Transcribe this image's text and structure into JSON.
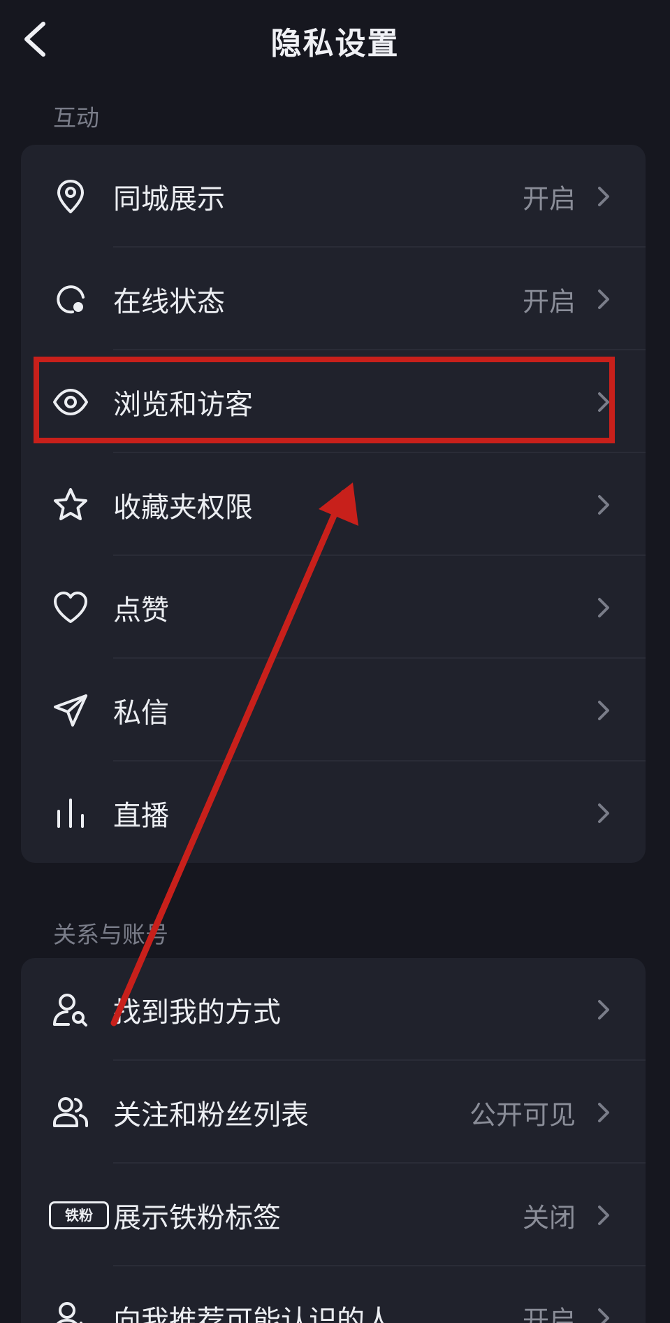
{
  "header": {
    "title": "隐私设置"
  },
  "sections": [
    {
      "title": "互动",
      "items": [
        {
          "label": "同城展示",
          "value": "开启",
          "icon": "location-pin-icon"
        },
        {
          "label": "在线状态",
          "value": "开启",
          "icon": "online-status-icon"
        },
        {
          "label": "浏览和访客",
          "value": "",
          "icon": "eye-icon"
        },
        {
          "label": "收藏夹权限",
          "value": "",
          "icon": "star-icon"
        },
        {
          "label": "点赞",
          "value": "",
          "icon": "heart-icon"
        },
        {
          "label": "私信",
          "value": "",
          "icon": "send-icon"
        },
        {
          "label": "直播",
          "value": "",
          "icon": "bars-icon"
        }
      ]
    },
    {
      "title": "关系与账号",
      "items": [
        {
          "label": "找到我的方式",
          "value": "",
          "icon": "user-search-icon"
        },
        {
          "label": "关注和粉丝列表",
          "value": "公开可见",
          "icon": "users-icon"
        },
        {
          "label": "展示铁粉标签",
          "value": "关闭",
          "icon": "tag-icon",
          "icon_text": "铁粉"
        },
        {
          "label": "向我推荐可能认识的人",
          "value": "开启",
          "icon": "user-add-icon"
        }
      ]
    }
  ],
  "annotation": {
    "box_color": "#c8201b",
    "arrow_color": "#c8201b"
  }
}
